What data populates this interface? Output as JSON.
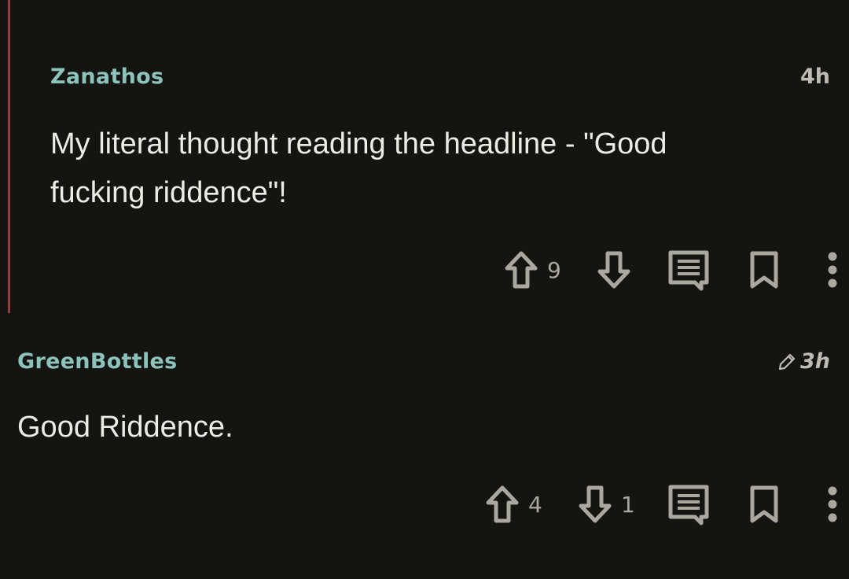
{
  "comments": [
    {
      "author": "Zanathos",
      "time": "4h",
      "edited": false,
      "body": "My literal thought reading the headline - \"Good fucking riddence\"!",
      "upvotes": "9",
      "downvotes": ""
    },
    {
      "author": "GreenBottles",
      "time": "3h",
      "edited": true,
      "body": "Good Riddence.",
      "upvotes": "4",
      "downvotes": "1"
    }
  ],
  "icons": {
    "upvote": "arrow-up-icon",
    "downvote": "arrow-down-icon",
    "reply": "comment-icon",
    "save": "bookmark-icon",
    "more": "more-vertical-icon",
    "edited": "pencil-icon"
  },
  "colors": {
    "background": "#141410",
    "author": "#8cc3bd",
    "body_text": "#ecebe4",
    "icon": "#a9a79e",
    "thread_bar": "#8f3f44"
  }
}
